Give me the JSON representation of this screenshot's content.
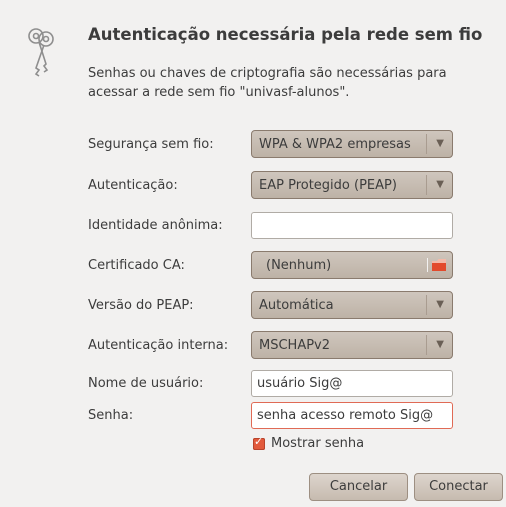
{
  "dialog": {
    "title": "Autenticação necessária pela rede sem fio",
    "description": "Senhas ou chaves de criptografia são necessárias para acessar a rede sem fio \"univasf-alunos\".",
    "icon": "keys-icon"
  },
  "form": {
    "wireless_security": {
      "label": "Segurança sem fio:",
      "value": "WPA & WPA2 empresas"
    },
    "authentication": {
      "label": "Autenticação:",
      "value": "EAP Protegido (PEAP)"
    },
    "anonymous_identity": {
      "label": "Identidade anônima:",
      "value": ""
    },
    "ca_certificate": {
      "label": "Certificado CA:",
      "value": "(Nenhum)"
    },
    "peap_version": {
      "label": "Versão do PEAP:",
      "value": "Automática"
    },
    "inner_authentication": {
      "label": "Autenticação interna:",
      "value": "MSCHAPv2"
    },
    "username": {
      "label": "Nome de usuário:",
      "value": "usuário Sig@"
    },
    "password": {
      "label": "Senha:",
      "value": "senha acesso remoto Sig@"
    },
    "show_password": {
      "label": "Mostrar senha",
      "checked": true
    }
  },
  "buttons": {
    "cancel": "Cancelar",
    "connect": "Conectar"
  },
  "colors": {
    "dialog_bg": "#f2f1f0",
    "combo_bg": "#c9c0b6",
    "focus_border": "#e06a55",
    "checkbox": "#e25a3c"
  }
}
